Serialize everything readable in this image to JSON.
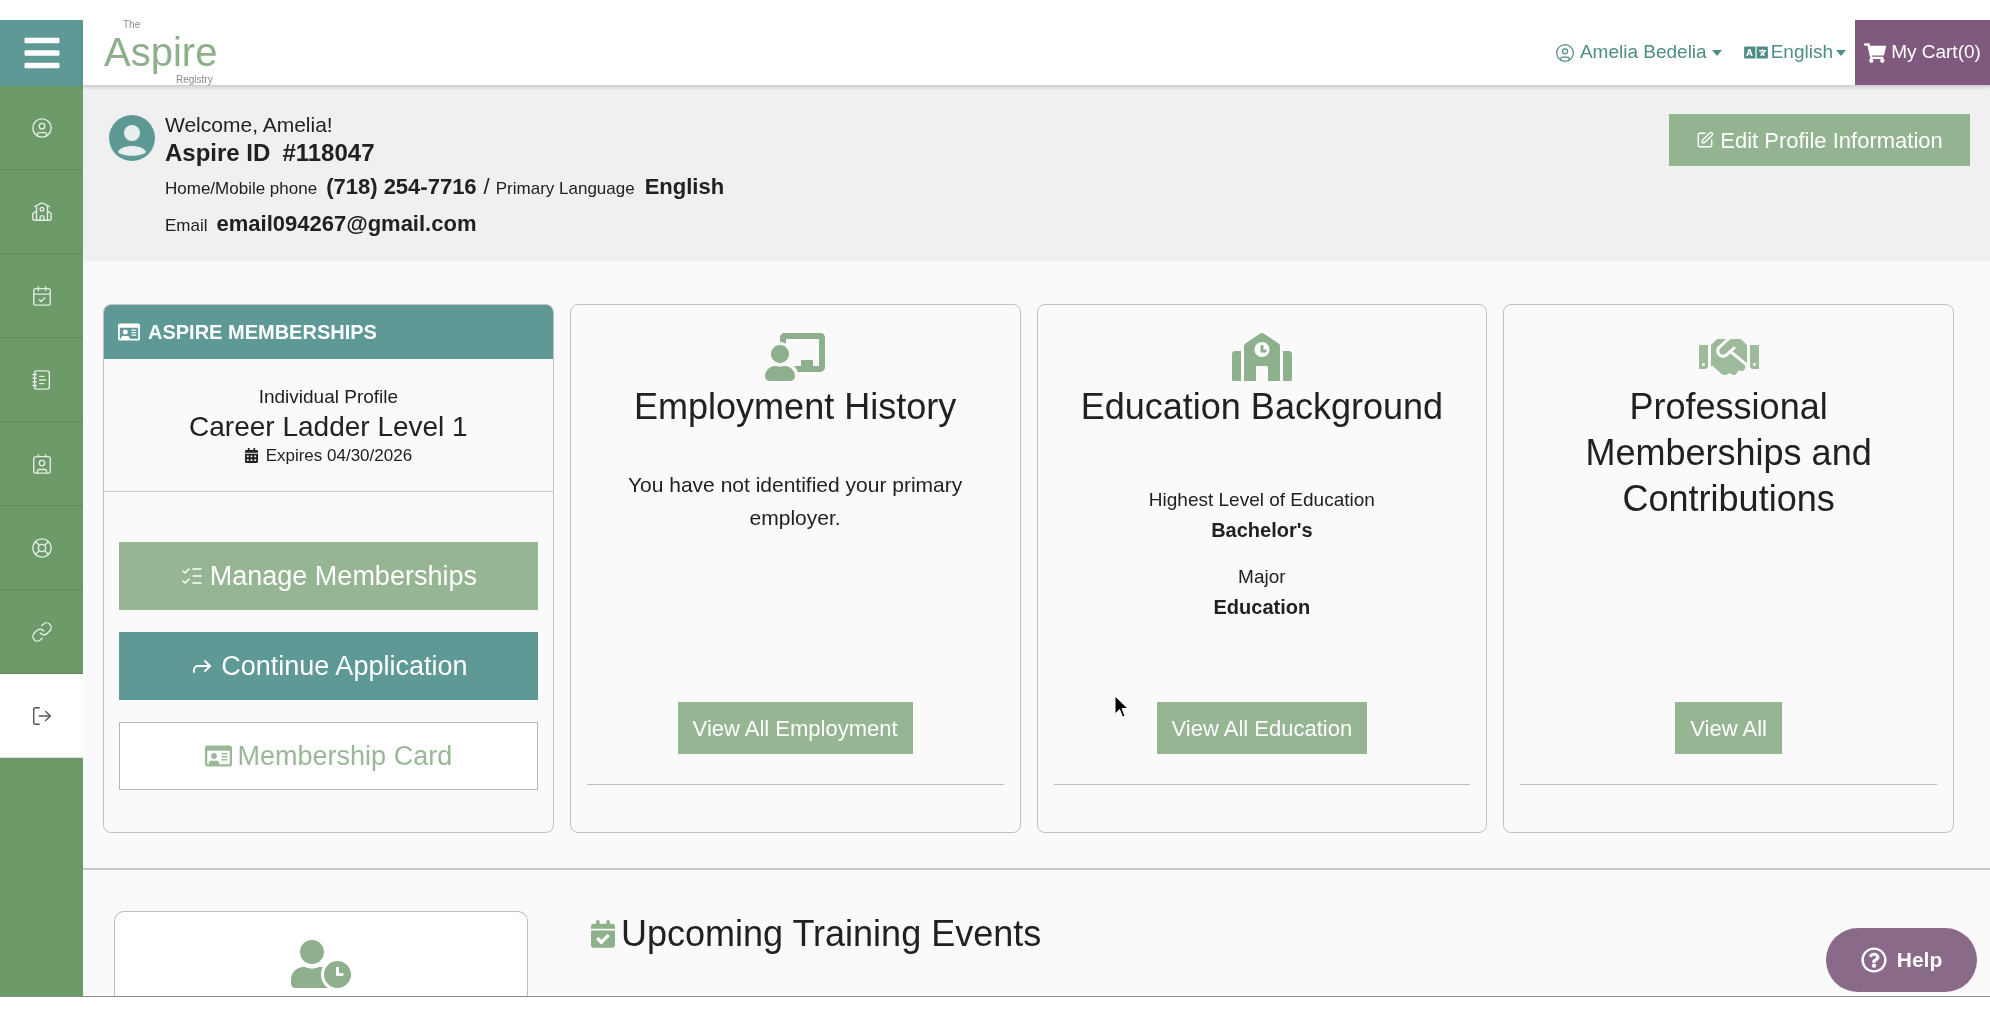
{
  "header": {
    "logo": {
      "top": "The",
      "name": "Aspire",
      "bottom": "Registry"
    },
    "user_menu": "Amelia Bedelia",
    "language_menu": "English",
    "cart": "My Cart(0)"
  },
  "sidebar": {
    "items": [
      {
        "selected": false
      },
      {
        "selected": false
      },
      {
        "selected": false
      },
      {
        "selected": false
      },
      {
        "selected": false
      },
      {
        "selected": false
      },
      {
        "selected": false
      },
      {
        "selected": true
      }
    ]
  },
  "profile": {
    "greeting": "Welcome, Amelia!",
    "id_label": "Aspire ID",
    "id_value": "#118047",
    "phone_label": "Home/Mobile phone",
    "phone": "(718) 254-7716",
    "separator": "/",
    "language_label": "Primary Language",
    "language": "English",
    "email_label": "Email",
    "email": "email094267@gmail.com",
    "edit_button": "Edit Profile Information"
  },
  "memberships": {
    "title": "ASPIRE MEMBERSHIPS",
    "profile_type": "Individual Profile",
    "membership": "Career Ladder Level 1",
    "expires": "Expires 04/30/2026",
    "buttons": [
      {
        "kind": "muted",
        "label": "Manage Memberships"
      },
      {
        "kind": "filled",
        "label": "Continue Application"
      },
      {
        "kind": "outline",
        "label": "Membership Card"
      }
    ]
  },
  "sections": [
    {
      "title": "Employment History",
      "message": "You have not identified your primary employer.",
      "button": "View All Employment"
    },
    {
      "title": "Education Background",
      "fields": [
        {
          "label": "Highest Level of Education",
          "value": "Bachelor's"
        },
        {
          "label": "Major",
          "value": "Education"
        }
      ],
      "button": "View All Education"
    },
    {
      "title": "Professional Memberships and Contributions",
      "button": "View All"
    }
  ],
  "training": {
    "title": "Upcoming Training Events"
  },
  "help_button": "Help"
}
